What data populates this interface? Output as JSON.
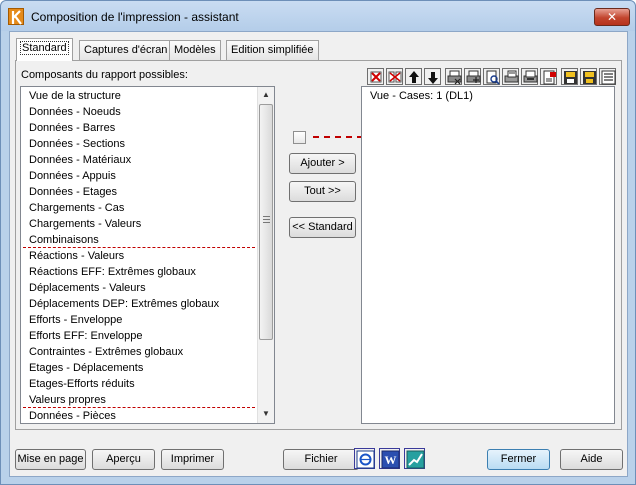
{
  "window": {
    "title": "Composition de l'impression - assistant",
    "close_label": "✕"
  },
  "tabs": [
    {
      "label": "Standard",
      "active": true
    },
    {
      "label": "Captures d'écran",
      "active": false
    },
    {
      "label": "Modèles",
      "active": false
    },
    {
      "label": "Edition simplifiée",
      "active": false
    }
  ],
  "left_panel": {
    "label": "Composants du rapport possibles:",
    "items": [
      "Vue de la structure",
      "Données - Noeuds",
      "Données - Barres",
      "Données - Sections",
      "Données - Matériaux",
      "Données - Appuis",
      "Données - Etages",
      "Chargements - Cas",
      "Chargements - Valeurs",
      "Combinaisons",
      "Réactions - Valeurs",
      "Réactions EFF: Extrêmes globaux",
      "Déplacements - Valeurs",
      "Déplacements DEP: Extrêmes globaux",
      "Efforts - Enveloppe",
      "Efforts EFF: Enveloppe",
      "Contraintes - Extrêmes globaux",
      "Etages - Déplacements",
      "Etages-Efforts réduits",
      "Valeurs propres",
      "Données - Pièces"
    ]
  },
  "middle": {
    "add_label": "Ajouter >",
    "all_label": "Tout >>",
    "standard_label": "<< Standard"
  },
  "right_panel": {
    "items": [
      "Vue - Cases: 1 (DL1)"
    ],
    "toolbar": [
      "delete-icon",
      "delete-all-icon",
      "move-up-icon",
      "move-down-icon",
      "print-icon",
      "print-settings-icon",
      "preview-icon",
      "print-page-icon",
      "print-all-icon",
      "page-setup-icon",
      "save-template-icon",
      "open-template-icon",
      "list-icon"
    ]
  },
  "bottom": {
    "page_setup_label": "Mise en page",
    "preview_label": "Aperçu",
    "print_label": "Imprimer",
    "file_label": "Fichier",
    "close_label": "Fermer",
    "help_label": "Aide",
    "icons": [
      "export-html-icon",
      "export-word-icon",
      "export-chart-icon"
    ]
  },
  "colors": {
    "separator": "#c00000",
    "titlebar": "#b9d1ea",
    "default_button": "#b9dcf3"
  }
}
